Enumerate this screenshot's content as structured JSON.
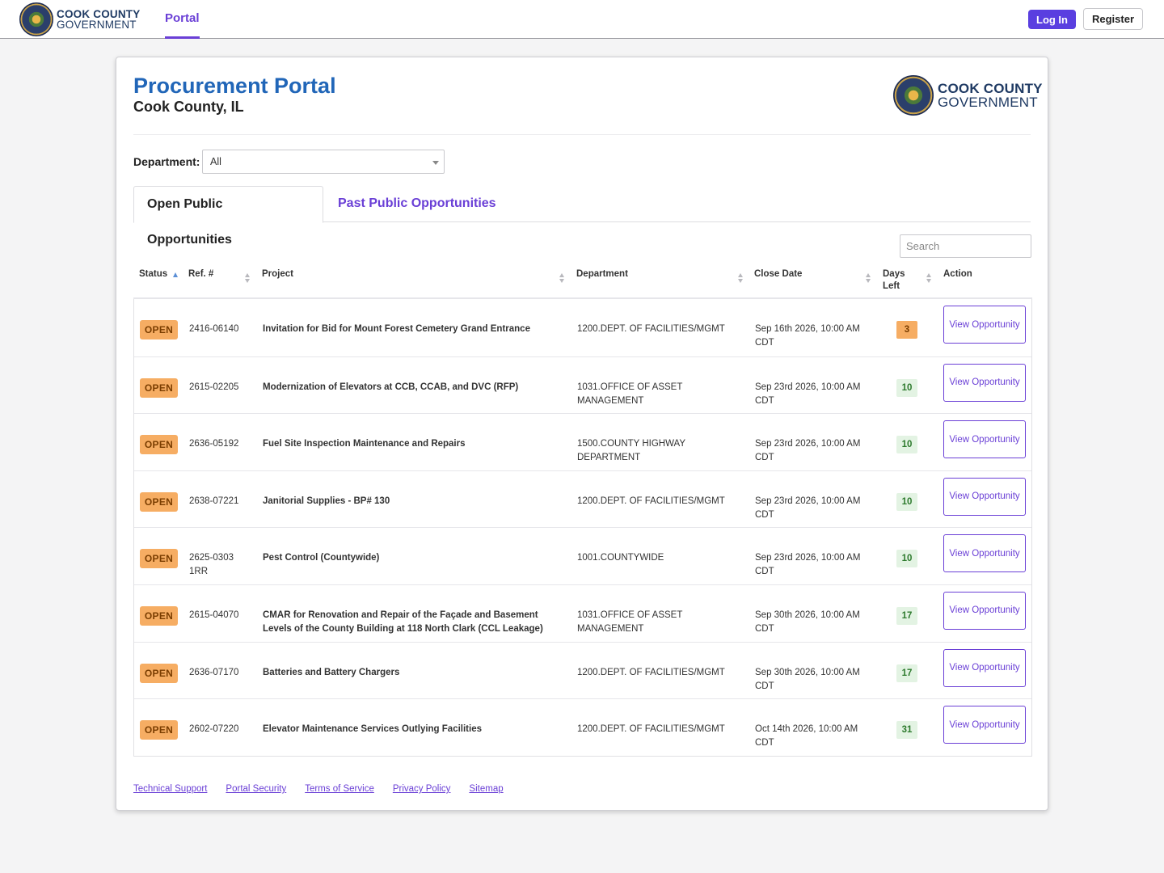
{
  "nav": {
    "brand_line1": "COOK COUNTY",
    "brand_line2": "GOVERNMENT",
    "portal_label": "Portal",
    "login_label": "Log In",
    "register_label": "Register"
  },
  "header": {
    "title": "Procurement Portal",
    "subtitle": "Cook County, IL",
    "brand_line1": "COOK COUNTY",
    "brand_line2": "GOVERNMENT"
  },
  "filter": {
    "department_label": "Department:",
    "department_value": "All"
  },
  "tabs": [
    {
      "label": "Open Public Opportunities",
      "active": true
    },
    {
      "label": "Past Public Opportunities",
      "active": false
    }
  ],
  "search": {
    "placeholder": "Search"
  },
  "table": {
    "columns": [
      "Status",
      "Ref. #",
      "Project",
      "Department",
      "Close Date",
      "Days Left",
      "Action"
    ],
    "rows": [
      {
        "status": "OPEN",
        "ref": "2416-06140",
        "project": "Invitation for Bid for Mount Forest Cemetery Grand Entrance",
        "department": "1200.DEPT. OF FACILITIES/MGMT",
        "close_date": "Sep 16th 2026, 10:00 AM CDT",
        "days_left": "3",
        "action": "View Opportunity"
      },
      {
        "status": "OPEN",
        "ref": "2615-02205",
        "project": "Modernization of Elevators at CCB, CCAB, and DVC (RFP)",
        "department": "1031.OFFICE OF ASSET MANAGEMENT",
        "close_date": "Sep 23rd 2026, 10:00 AM CDT",
        "days_left": "10",
        "action": "View Opportunity"
      },
      {
        "status": "OPEN",
        "ref": "2636-05192",
        "project": "Fuel Site Inspection Maintenance and Repairs",
        "department": "1500.COUNTY HIGHWAY DEPARTMENT",
        "close_date": "Sep 23rd 2026, 10:00 AM CDT",
        "days_left": "10",
        "action": "View Opportunity"
      },
      {
        "status": "OPEN",
        "ref": "2638-07221",
        "project": "Janitorial Supplies - BP# 130",
        "department": "1200.DEPT. OF FACILITIES/MGMT",
        "close_date": "Sep 23rd 2026, 10:00 AM CDT",
        "days_left": "10",
        "action": "View Opportunity"
      },
      {
        "status": "OPEN",
        "ref": "2625-03031RR",
        "project": "Pest Control (Countywide)",
        "department": "1001.COUNTYWIDE",
        "close_date": "Sep 23rd 2026, 10:00 AM CDT",
        "days_left": "10",
        "action": "View Opportunity"
      },
      {
        "status": "OPEN",
        "ref": "2615-04070",
        "project": "CMAR for Renovation and Repair of the Façade and Basement Levels of the County Building at 118 North Clark (CCL Leakage)",
        "department": "1031.OFFICE OF ASSET MANAGEMENT",
        "close_date": "Sep 30th 2026, 10:00 AM CDT",
        "days_left": "17",
        "action": "View Opportunity"
      },
      {
        "status": "OPEN",
        "ref": "2636-07170",
        "project": "Batteries and Battery Chargers",
        "department": "1200.DEPT. OF FACILITIES/MGMT",
        "close_date": "Sep 30th 2026, 10:00 AM CDT",
        "days_left": "17",
        "action": "View Opportunity"
      },
      {
        "status": "OPEN",
        "ref": "2602-07220",
        "project": "Elevator Maintenance Services Outlying Facilities",
        "department": "1200.DEPT. OF FACILITIES/MGMT",
        "close_date": "Oct 14th 2026, 10:00 AM CDT",
        "days_left": "31",
        "action": "View Opportunity"
      }
    ]
  },
  "footer": {
    "links": [
      "Technical Support",
      "Portal Security",
      "Terms of Service",
      "Privacy Policy",
      "Sitemap"
    ]
  },
  "colors": {
    "accent": "#6a3fd6",
    "title_blue": "#2166b8",
    "status_open": "#f6ad63",
    "days_ok": "#e3f3e3"
  }
}
